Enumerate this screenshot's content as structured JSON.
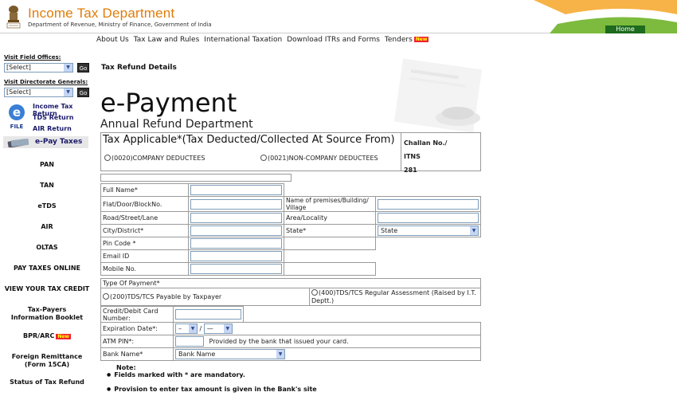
{
  "header": {
    "title": "Income Tax Department",
    "subtitle": "Department of Revenue, Ministry of Finance, Government of India",
    "home": "Home"
  },
  "menu": [
    {
      "label": "About Us"
    },
    {
      "label": "Tax Law and Rules"
    },
    {
      "label": "International Taxation"
    },
    {
      "label": "Download ITRs and Forms"
    },
    {
      "label": "Tenders",
      "badge": "New"
    }
  ],
  "sidebar": {
    "field_offices_label": "Visit Field Offices:",
    "field_offices_value": "[Select]",
    "directorate_label": "Visit Directorate Generals:",
    "directorate_value": "[Select]",
    "go": "Go",
    "efile_links": [
      "Income Tax Return",
      "TDS Return",
      "AIR Return"
    ],
    "efile_icon_text": "FILE",
    "epay": "e-Pay Taxes",
    "nav": [
      "PAN",
      "TAN",
      "eTDS",
      "AIR",
      "OLTAS",
      "PAY TAXES ONLINE",
      "VIEW YOUR TAX CREDIT",
      "Tax-Payers Information Booklet",
      "BPR/ARC",
      "Foreign Remittance (Form 15CA)",
      "Status of Tax Refund"
    ],
    "bpr_badge": "New"
  },
  "main": {
    "section_heading": "Tax Refund Details",
    "title": "e-Payment",
    "subtitle": "Annual Refund Department",
    "tax_applicable": "Tax Applicable*(Tax Deducted/Collected At Source From)",
    "option_company": "(0020)COMPANY DEDUCTEES",
    "option_noncompany": "(0021)NON-COMPANY DEDUCTEES",
    "challan_line1": "Challan No./",
    "challan_line2": "ITNS",
    "challan_line3": "281",
    "fields": {
      "full_name": "Full Name*",
      "flat": "Flat/Door/BlockNo.",
      "premises": "Name of premises/Building/ Village",
      "road": "Road/Street/Lane",
      "area": "Area/Locality",
      "city": "City/District*",
      "state_label": "State*",
      "state_value": "State",
      "pin": "Pin Code *",
      "email": "Email ID",
      "mobile": "Mobile No."
    },
    "payment_type": "Type Of Payment*",
    "payment_200": "(200)TDS/TCS Payable by Taxpayer",
    "payment_400": "(400)TDS/TCS Regular Assessment (Raised by I.T. Deptt.)",
    "card_number": "Credit/Debit Card Number:",
    "expiration": "Expiration Date*:",
    "exp_month": "–",
    "exp_sep": "/",
    "exp_year": "—",
    "atm_pin": "ATM PIN*:",
    "atm_note": "Provided by the bank that issued your card.",
    "bank_label": "Bank Name*",
    "bank_value": "Bank Name",
    "note_title": "Note:",
    "note_1": "Fields marked with * are mandatory.",
    "note_2": "Provision to enter tax amount is given in the Bank's site"
  },
  "colors": {
    "brand": "#e07c0a",
    "home_bg": "#1d6b1d",
    "new_badge": "#e23"
  }
}
